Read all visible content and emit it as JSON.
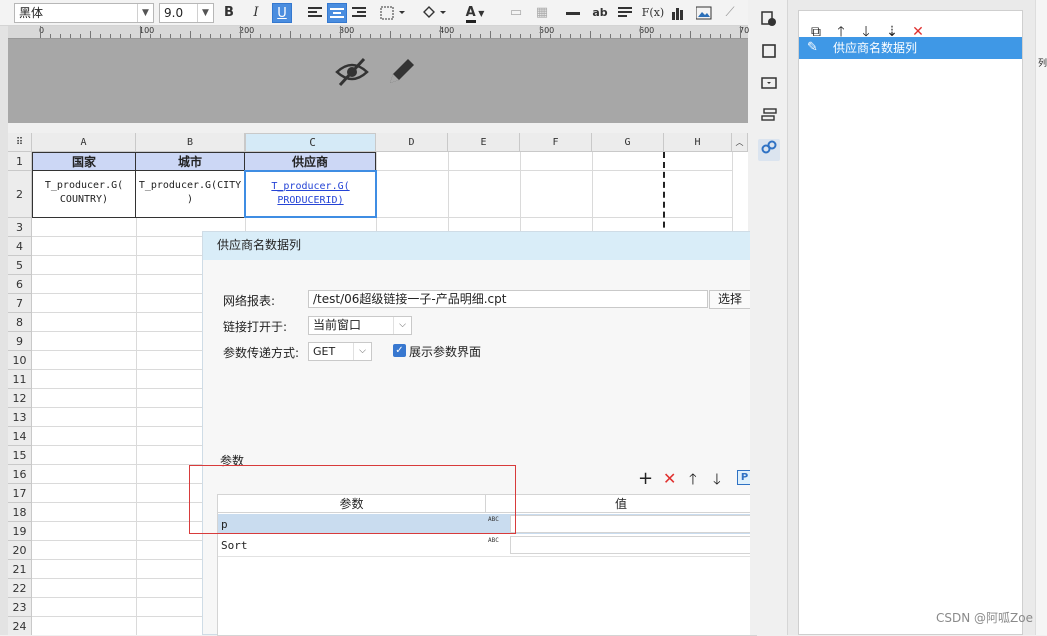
{
  "toolbar": {
    "font_name": "黑体",
    "font_size": "9.0",
    "bold": "B",
    "italic": "I",
    "underline": "U",
    "text_color_letter": "A",
    "ab_label": "ab",
    "formula_label": "F(x)"
  },
  "ruler": {
    "marks": [
      "0",
      "100",
      "200",
      "300",
      "400",
      "500",
      "600",
      "70"
    ]
  },
  "grid": {
    "columns": [
      "A",
      "B",
      "C",
      "D",
      "E",
      "F",
      "G",
      "H"
    ],
    "rows": [
      "1",
      "2",
      "3",
      "4",
      "5",
      "6",
      "7",
      "8",
      "9",
      "10",
      "11",
      "12",
      "13",
      "14",
      "15",
      "16",
      "17",
      "18",
      "19",
      "20",
      "21",
      "22",
      "23",
      "24"
    ],
    "header_cells": [
      "国家",
      "城市",
      "供应商"
    ],
    "formula_cells": [
      {
        "line1": "T_producer.G(",
        "line2": "COUNTRY)"
      },
      {
        "line1": "T_producer.G(CITY",
        "line2": ")"
      },
      {
        "line1": "T_producer.G(",
        "line2": "PRODUCERID)"
      }
    ]
  },
  "dialog": {
    "title": "供应商名数据列",
    "network_report_label": "网络报表:",
    "network_report_value": "/test/06超级链接一子-产品明细.cpt",
    "choose_button": "选择",
    "open_in_label": "链接打开于:",
    "open_in_value": "当前窗口",
    "param_method_label": "参数传递方式:",
    "param_method_value": "GET",
    "show_params_label": "展示参数界面",
    "show_params_checked": true,
    "params_section_label": "参数",
    "table_headers": [
      "参数",
      "值"
    ],
    "params": [
      {
        "name": "p",
        "type": "ABC"
      },
      {
        "name": "Sort",
        "type": "ABC"
      }
    ],
    "p_button": "P"
  },
  "right_panel": {
    "list_items": [
      "供应商名数据列"
    ]
  },
  "edge_labels": [
    "列"
  ],
  "watermark": "CSDN @阿呱Zoe",
  "colors": {
    "accent": "#3f98e6",
    "header_fill": "#ccd7f5",
    "delete_red": "#e0302e",
    "link_blue": "#2544d6"
  }
}
